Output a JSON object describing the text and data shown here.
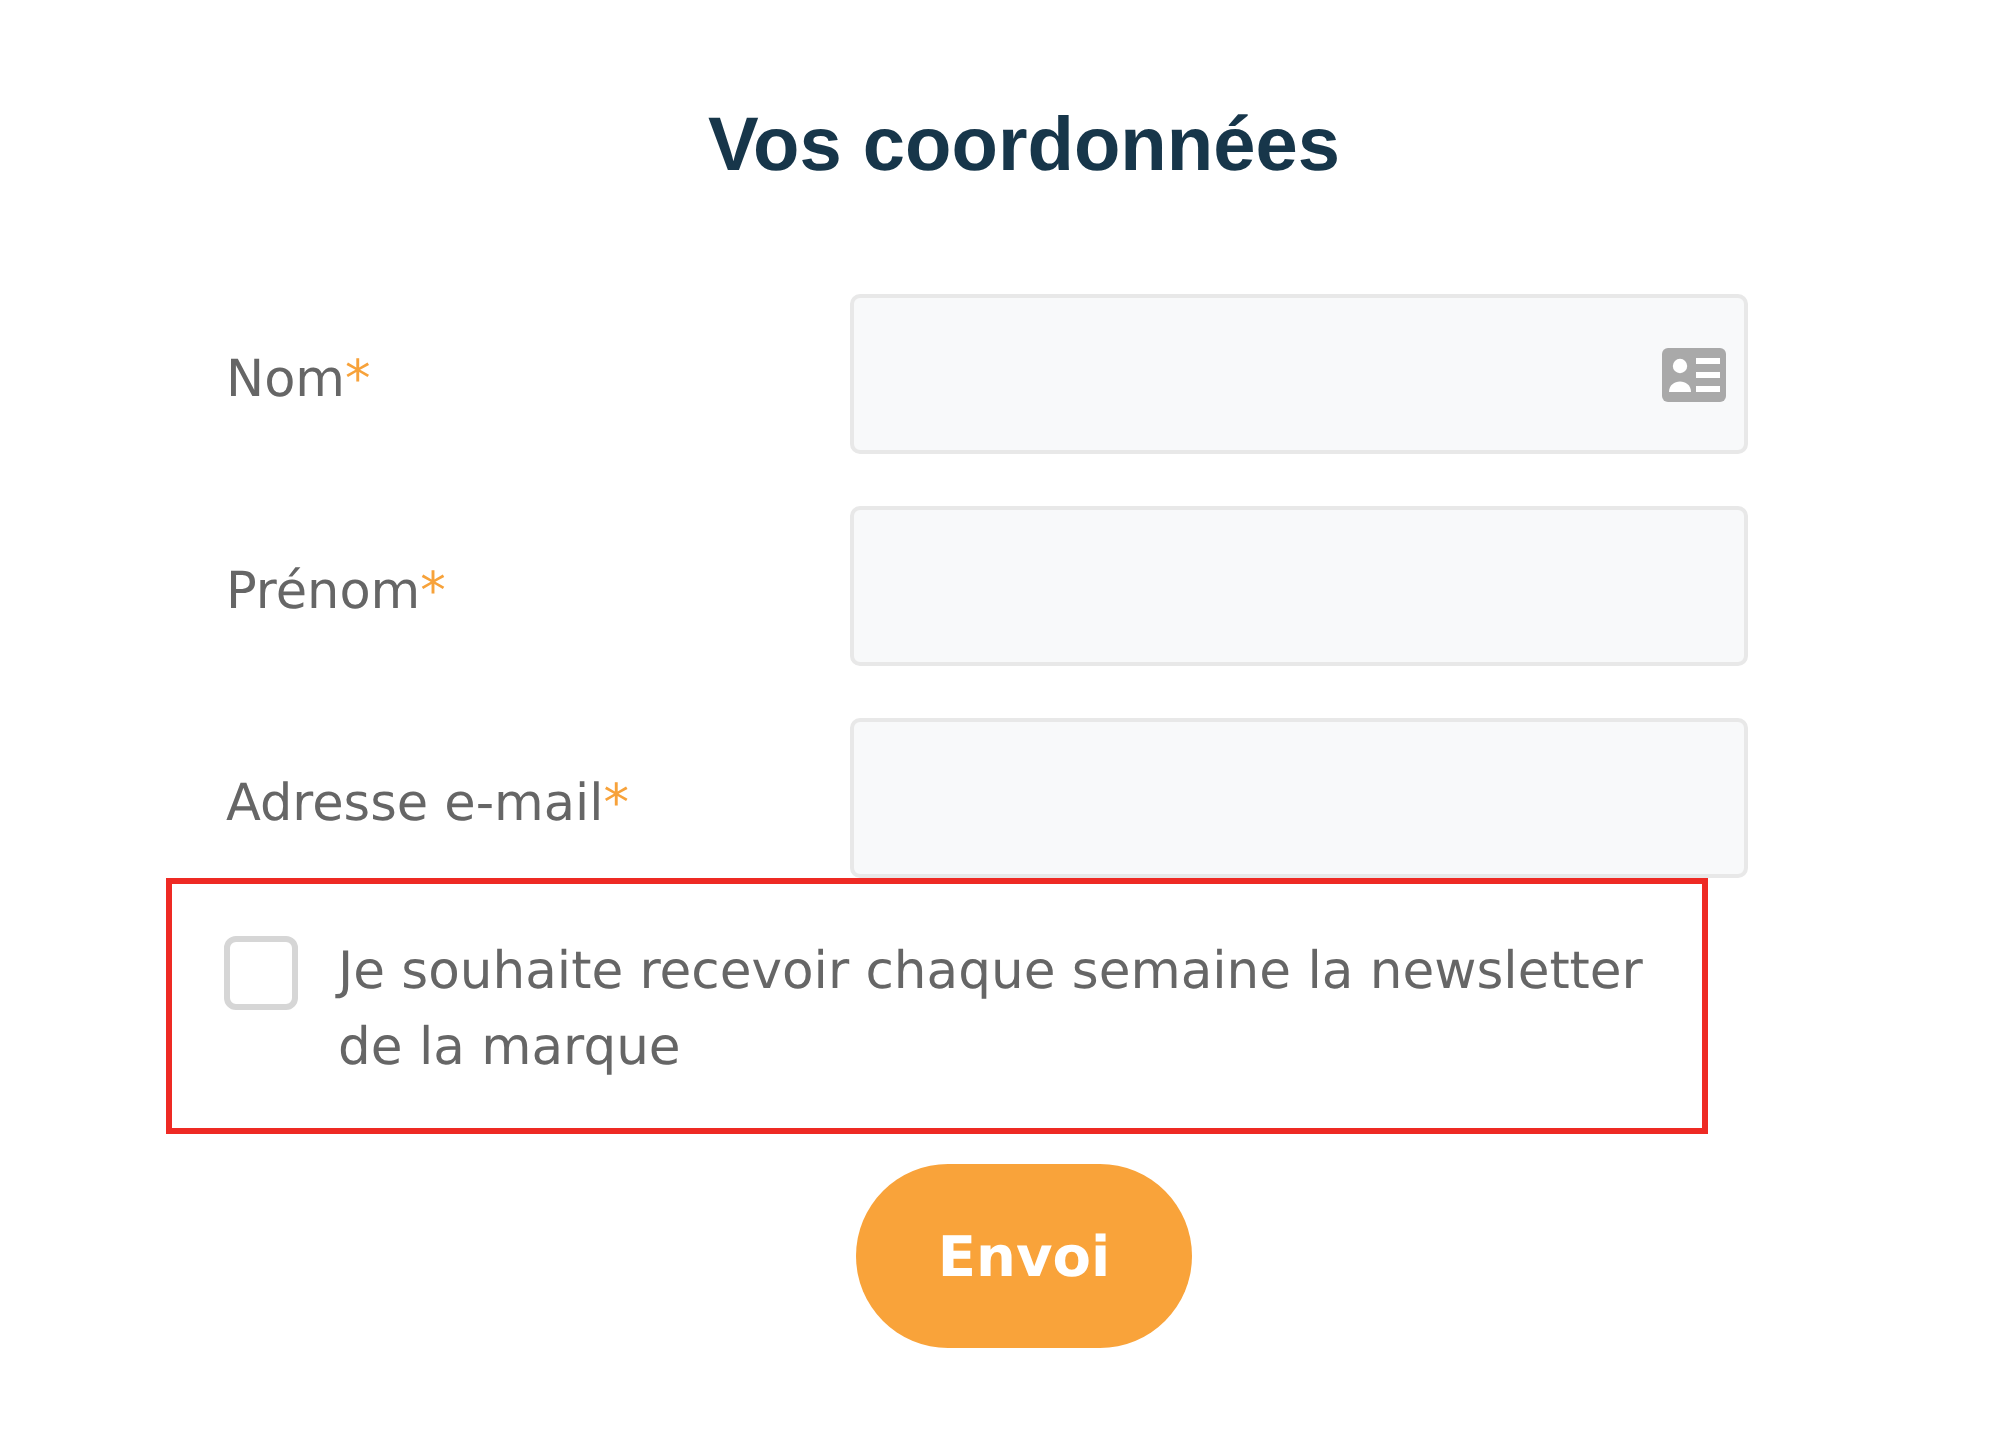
{
  "title": "Vos coordonnées",
  "fields": [
    {
      "label": "Nom",
      "required_mark": "*",
      "trailing_icon": true
    },
    {
      "label": "Prénom",
      "required_mark": "*",
      "trailing_icon": false
    },
    {
      "label": "Adresse e-mail",
      "required_mark": "*",
      "trailing_icon": false
    }
  ],
  "newsletter": {
    "label": "Je souhaite recevoir chaque semaine la newsletter de la marque",
    "checked": false,
    "highlighted": true
  },
  "submit": {
    "label": "Envoi"
  }
}
